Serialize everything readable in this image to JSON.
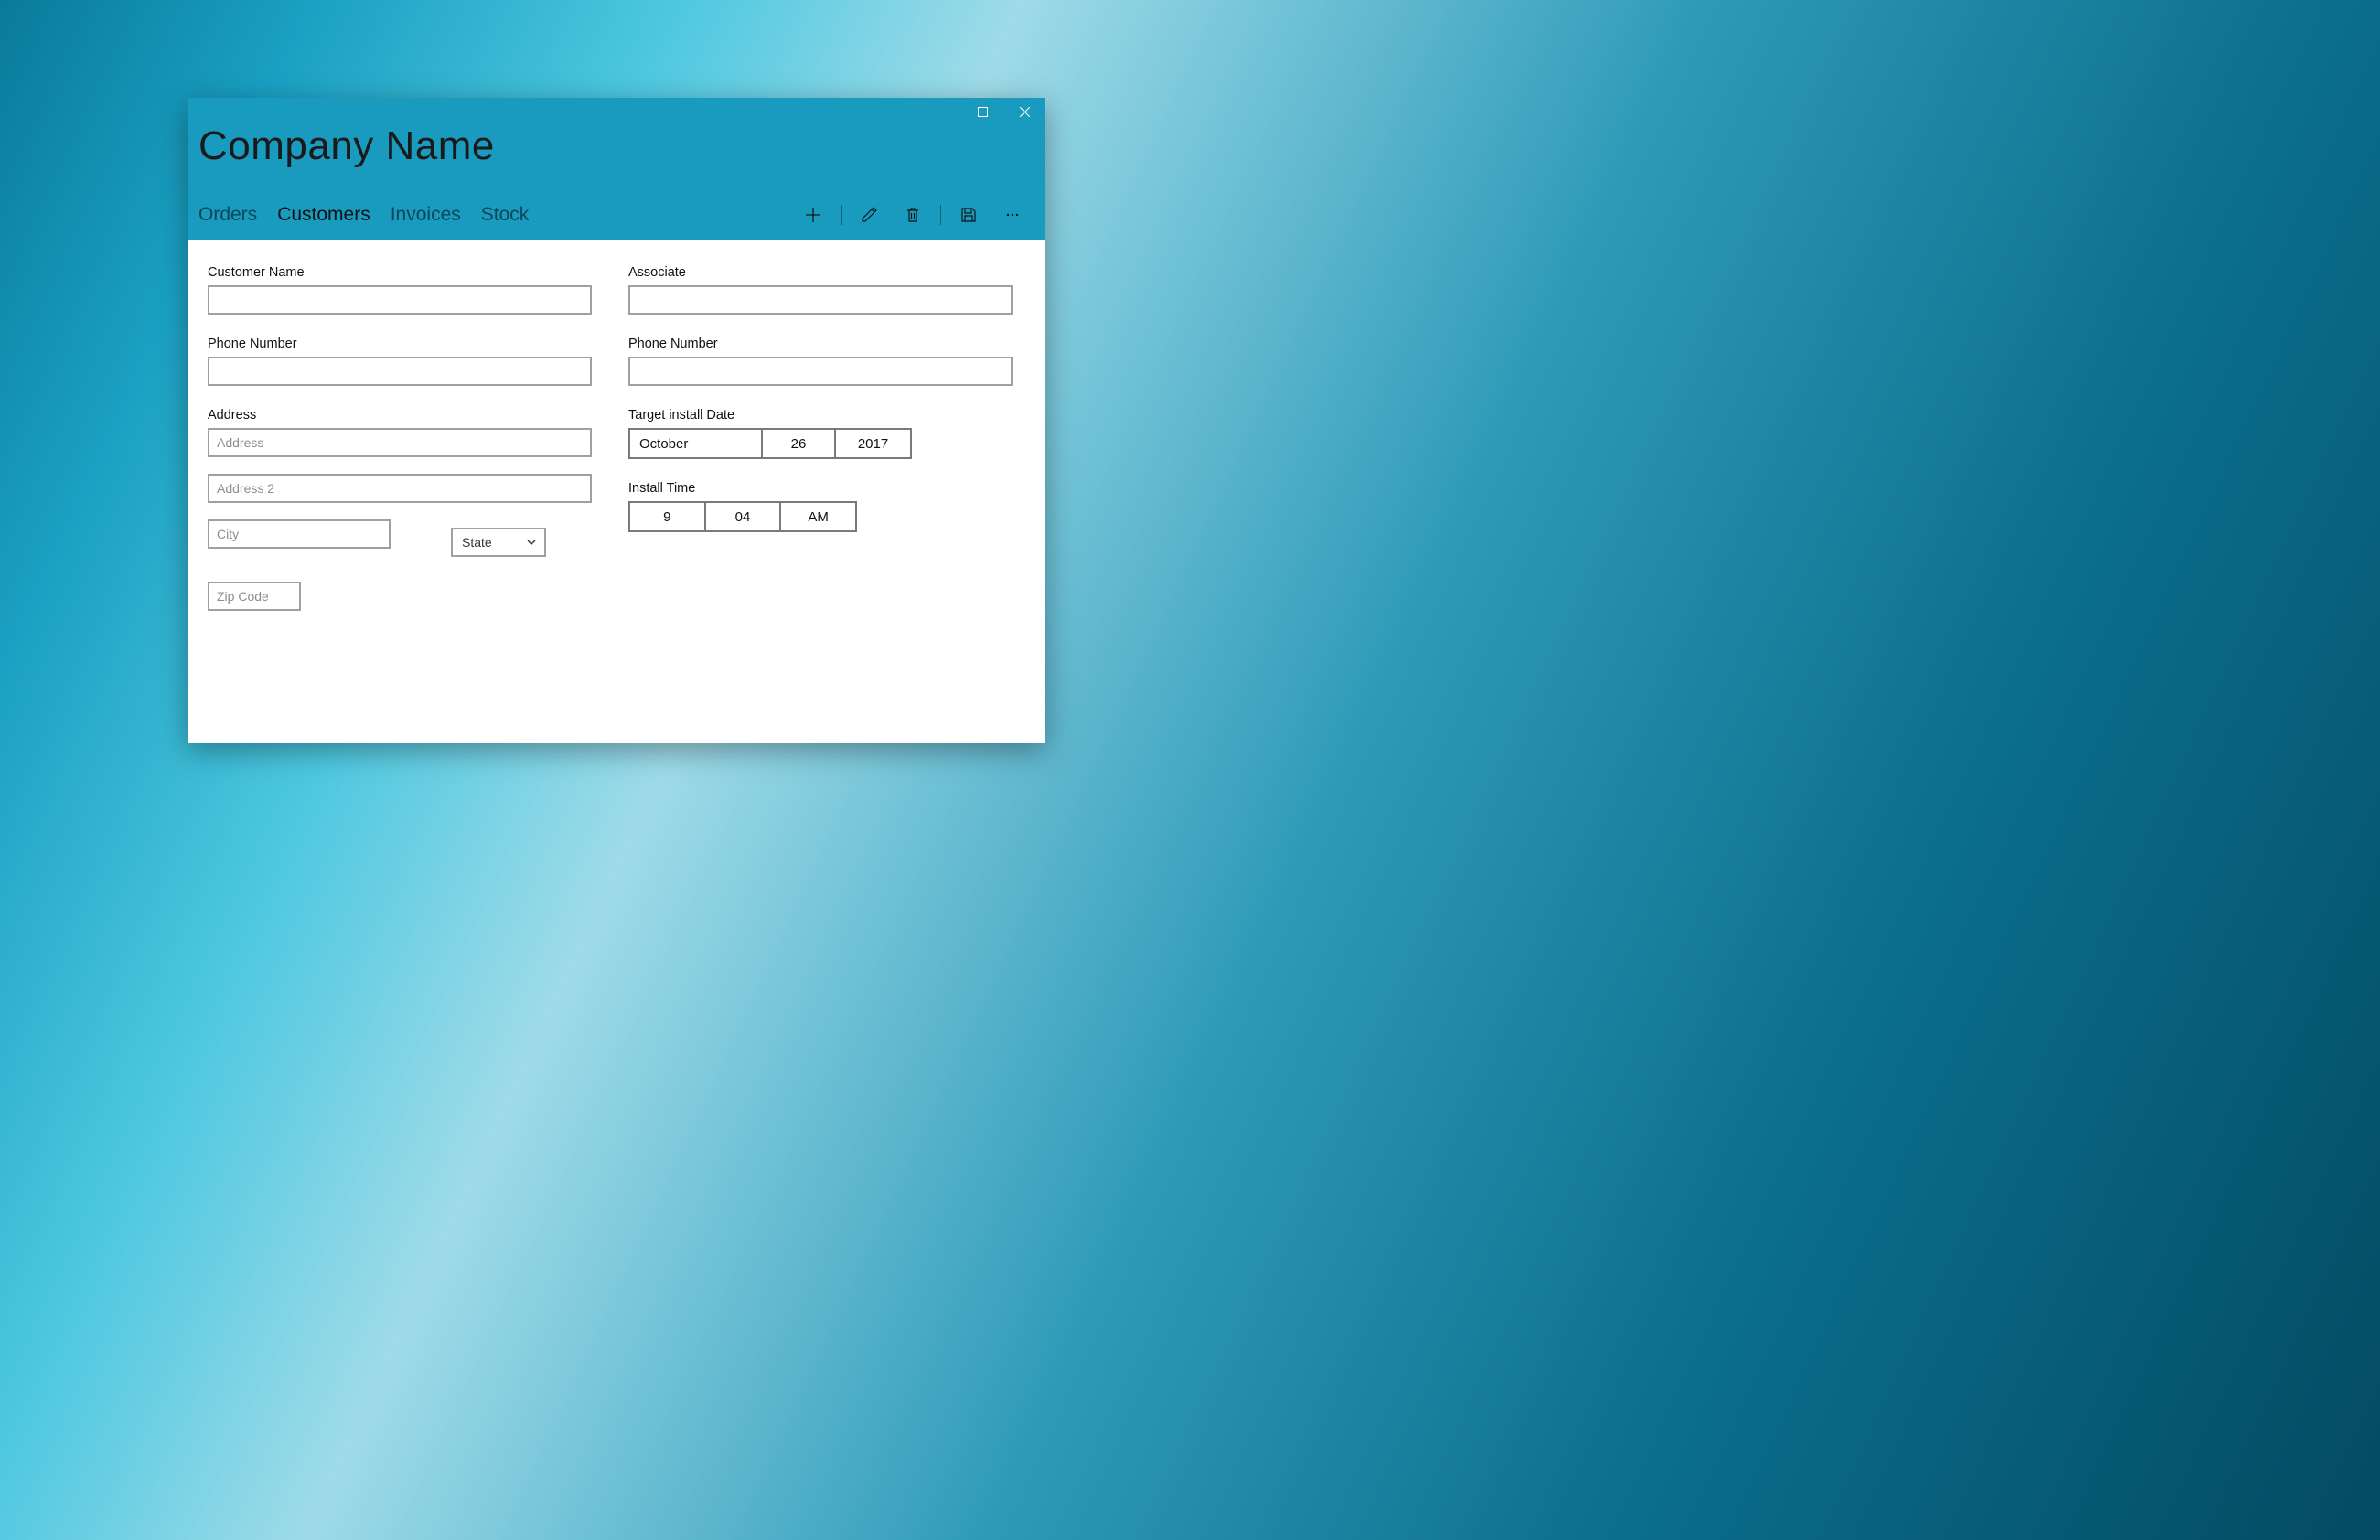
{
  "app": {
    "title": "Company Name"
  },
  "tabs": {
    "orders": "Orders",
    "customers": "Customers",
    "invoices": "Invoices",
    "stock": "Stock",
    "active": "customers"
  },
  "form": {
    "left": {
      "customer_name": {
        "label": "Customer Name",
        "value": ""
      },
      "phone": {
        "label": "Phone Number",
        "value": ""
      },
      "address": {
        "label": "Address",
        "line1_placeholder": "Address",
        "line2_placeholder": "Address 2",
        "city_placeholder": "City",
        "state_label": "State",
        "zip_placeholder": "Zip Code"
      }
    },
    "right": {
      "associate": {
        "label": "Associate",
        "value": ""
      },
      "phone": {
        "label": "Phone Number",
        "value": ""
      },
      "install_date": {
        "label": "Target install Date",
        "month": "October",
        "day": "26",
        "year": "2017"
      },
      "install_time": {
        "label": "Install Time",
        "hour": "9",
        "minute": "04",
        "ampm": "AM"
      }
    }
  }
}
